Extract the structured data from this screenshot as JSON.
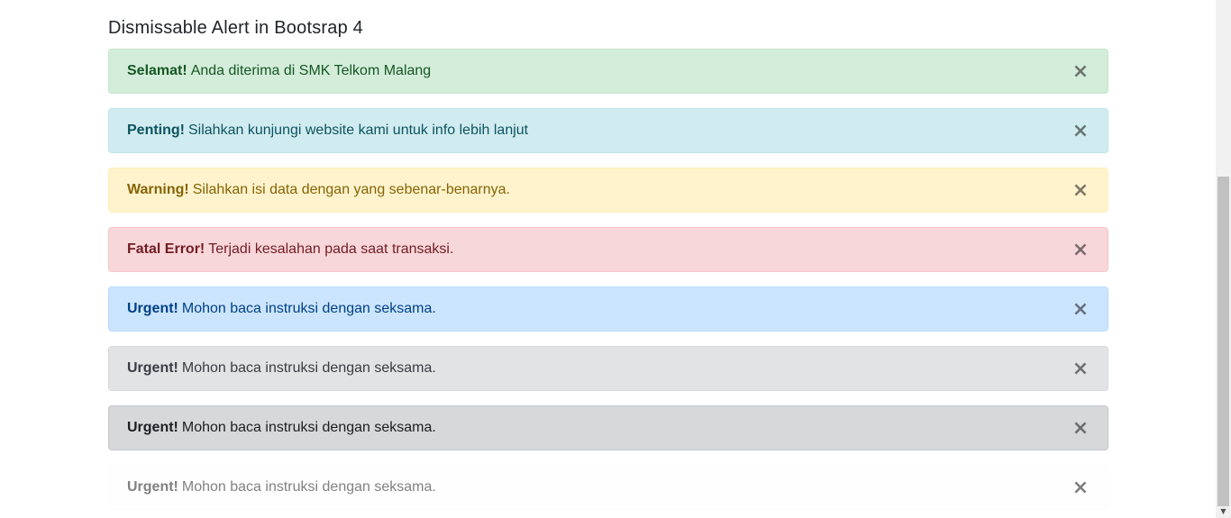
{
  "page_title": "Dismissable Alert in Bootsrap 4",
  "alerts": [
    {
      "variant": "success",
      "strong": "Selamat!",
      "message": "Anda diterima di SMK Telkom Malang",
      "close": "×"
    },
    {
      "variant": "info",
      "strong": "Penting!",
      "message": "Silahkan kunjungi website kami untuk info lebih lanjut",
      "close": "×"
    },
    {
      "variant": "warning",
      "strong": "Warning!",
      "message": "Silahkan isi data dengan yang sebenar-benarnya.",
      "close": "×"
    },
    {
      "variant": "danger",
      "strong": "Fatal Error!",
      "message": "Terjadi kesalahan pada saat transaksi.",
      "close": "×"
    },
    {
      "variant": "primary",
      "strong": "Urgent!",
      "message": "Mohon baca instruksi dengan seksama.",
      "close": "×"
    },
    {
      "variant": "secondary",
      "strong": "Urgent!",
      "message": "Mohon baca instruksi dengan seksama.",
      "close": "×"
    },
    {
      "variant": "dark",
      "strong": "Urgent!",
      "message": "Mohon baca instruksi dengan seksama.",
      "close": "×"
    },
    {
      "variant": "light",
      "strong": "Urgent!",
      "message": "Mohon baca instruksi dengan seksama.",
      "close": "×"
    }
  ],
  "scrollbar": {
    "down_arrow": "▼"
  }
}
